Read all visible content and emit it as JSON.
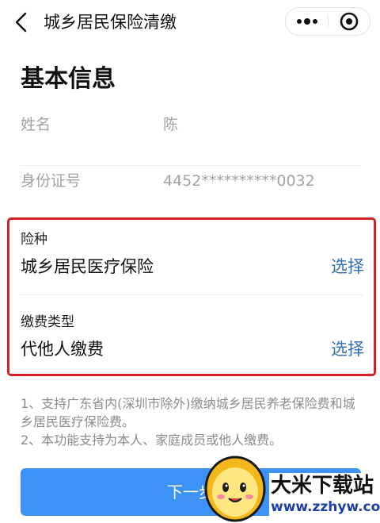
{
  "nav": {
    "title": "城乡居民保险清缴"
  },
  "basic_info": {
    "title": "基本信息",
    "fields": [
      {
        "label": "姓名",
        "value": "陈"
      },
      {
        "label": "身份证号",
        "value": "4452**********0032"
      }
    ]
  },
  "selections": [
    {
      "label": "险种",
      "value": "城乡居民医疗保险",
      "action": "选择"
    },
    {
      "label": "缴费类型",
      "value": "代他人缴费",
      "action": "选择"
    }
  ],
  "notes": [
    "1、支持广东省内(深圳市除外)缴纳城乡居民养老保险费和城乡居民医疗保险费。",
    "2、本功能支持为本人、家庭成员或他人缴费。"
  ],
  "next_button": {
    "label": "下一步"
  },
  "watermark": {
    "name": "大米下载站",
    "url": "www.zzhyw.com"
  },
  "colors": {
    "primary_button": "#3d92f5",
    "action_link": "#2f6fb5",
    "highlight_border": "#d71f26"
  }
}
